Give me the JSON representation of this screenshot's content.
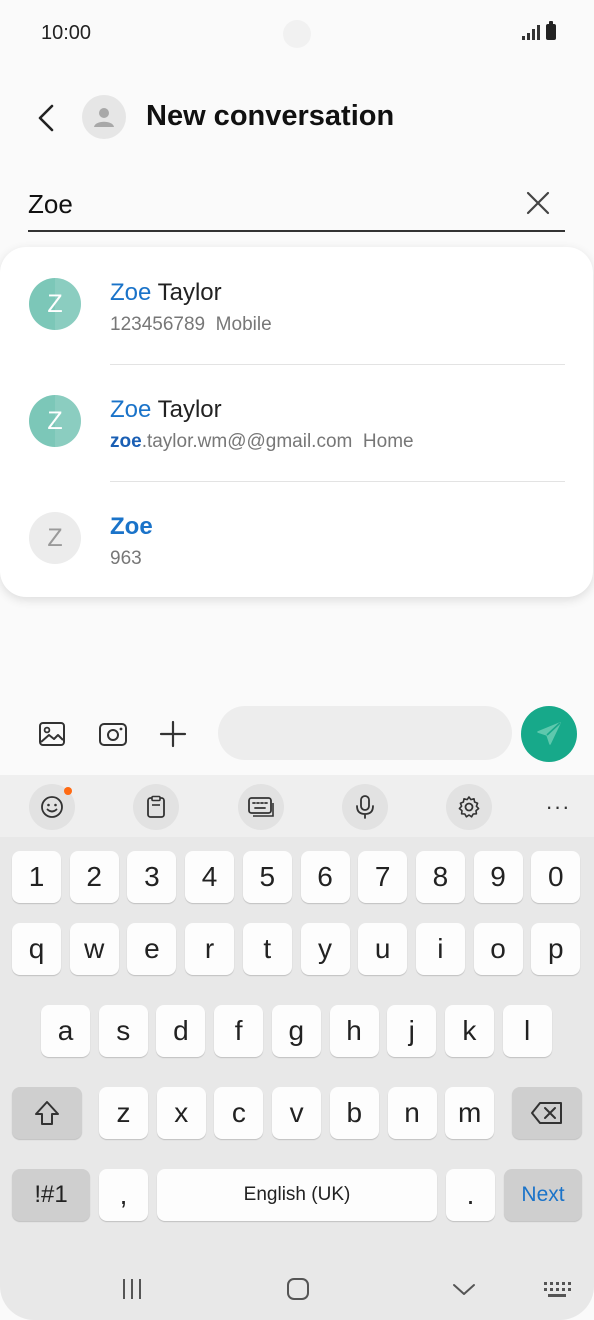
{
  "status_bar": {
    "time": "10:00"
  },
  "header": {
    "title": "New conversation"
  },
  "search": {
    "value": "Zoe"
  },
  "suggestions": [
    {
      "avatar_letter": "Z",
      "name_match": "Zoe",
      "name_rest": " Taylor",
      "detail_match": "",
      "detail_rest": "123456789",
      "label": "Mobile"
    },
    {
      "avatar_letter": "Z",
      "name_match": "Zoe",
      "name_rest": " Taylor",
      "detail_match": "zoe",
      "detail_rest": ".taylor.wm@@gmail.com",
      "label": "Home"
    },
    {
      "avatar_letter": "Z",
      "name_match": "Zoe",
      "name_rest": "",
      "detail_match": "",
      "detail_rest": "963",
      "label": ""
    }
  ],
  "keyboard": {
    "number_row": [
      "1",
      "2",
      "3",
      "4",
      "5",
      "6",
      "7",
      "8",
      "9",
      "0"
    ],
    "row1": [
      "q",
      "w",
      "e",
      "r",
      "t",
      "y",
      "u",
      "i",
      "o",
      "p"
    ],
    "row2": [
      "a",
      "s",
      "d",
      "f",
      "g",
      "h",
      "j",
      "k",
      "l"
    ],
    "row3": [
      "z",
      "x",
      "c",
      "v",
      "b",
      "n",
      "m"
    ],
    "symbols_label": "!#1",
    "comma_label": ",",
    "space_label": "English (UK)",
    "period_label": ".",
    "action_label": "Next",
    "toolbar_more": "···"
  },
  "colors": {
    "accent": "#1a73c9",
    "send": "#17a98a",
    "avatar_green": "#7cc7b8",
    "badge": "#ff6a13"
  }
}
